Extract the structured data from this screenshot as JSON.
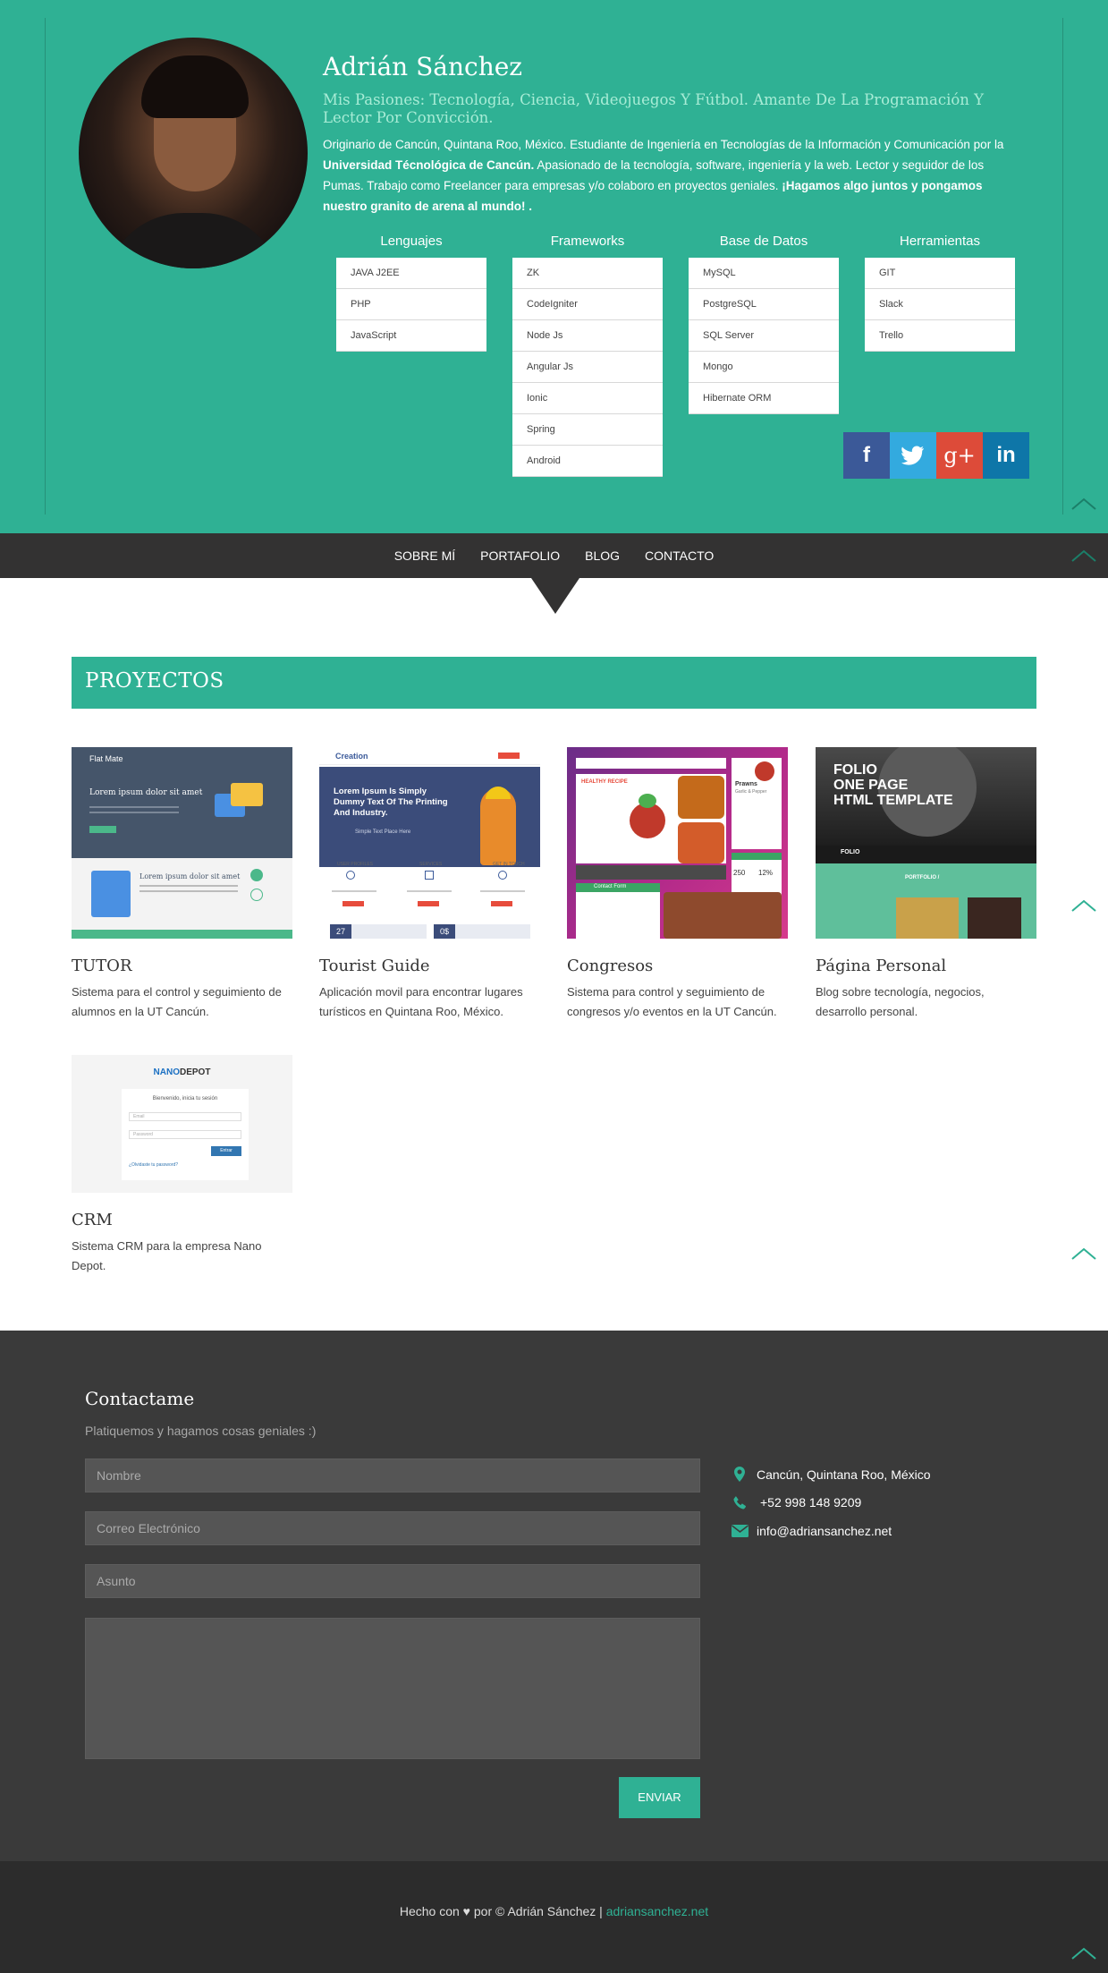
{
  "profile": {
    "name": "Adrián Sánchez",
    "tagline": "Mis Pasiones: Tecnología, Ciencia, Videojuegos Y Fútbol. Amante De La Programación Y Lector Por Convicción.",
    "bio_part1": "Originario de Cancún, Quintana Roo, México. Estudiante de Ingeniería en Tecnologías de la Información y Comunicación por la ",
    "bio_bold1": "Universidad Técnológica de Cancún.",
    "bio_part2": " Apasionado de la tecnología, software, ingeniería y la web. Lector y seguidor de los Pumas. Trabajo como Freelancer para empresas y/o colaboro en proyectos geniales. ",
    "bio_bold2": "¡Hagamos algo juntos y pongamos nuestro granito de arena al mundo! ."
  },
  "skills": [
    {
      "title": "Lenguajes",
      "items": [
        "JAVA J2EE",
        "PHP",
        "JavaScript"
      ]
    },
    {
      "title": "Frameworks",
      "items": [
        "ZK",
        "CodeIgniter",
        "Node Js",
        "Angular Js",
        "Ionic",
        "Spring",
        "Android"
      ]
    },
    {
      "title": "Base de Datos",
      "items": [
        "MySQL",
        "PostgreSQL",
        "SQL Server",
        "Mongo",
        "Hibernate ORM"
      ]
    },
    {
      "title": "Herramientas",
      "items": [
        "GIT",
        "Slack",
        "Trello"
      ]
    }
  ],
  "social": {
    "facebook": "f",
    "twitter": "t",
    "googleplus": "g+",
    "linkedin": "in"
  },
  "nav": [
    "SOBRE MÍ",
    "PORTAFOLIO",
    "BLOG",
    "CONTACTO"
  ],
  "projects_title": "PROYECTOS",
  "projects": [
    {
      "title": "TUTOR",
      "desc": "Sistema para el control y seguimiento de alumnos en la UT Cancún.",
      "thumb": {
        "brand": "Flat Mate",
        "hero": "Lorem ipsum dolor sit amet",
        "lower": "Lorem ipsum dolor sit amet"
      }
    },
    {
      "title": "Tourist Guide",
      "desc": "Aplicación movil para encontrar lugares turísticos en Quintana Roo, México.",
      "thumb": {
        "brand": "Creation",
        "hero": "Lorem Ipsum Is Simply Dummy Text Of The Printing And Industry.",
        "cta": "Simple Text Place Here",
        "cols": [
          "USER PROFILES",
          "SERVICES",
          "GET IN TOUCH"
        ],
        "nums": [
          "27",
          "0$"
        ]
      }
    },
    {
      "title": "Congresos",
      "desc": "Sistema para control y seguimiento de congresos y/o eventos en la UT Cancún.",
      "thumb": {
        "badge": "HEALTHY RECIPE",
        "card": "Prawns",
        "card_sub": "Garlic & Pepper",
        "stats": [
          "250",
          "12%"
        ],
        "form": "Contact Form"
      }
    },
    {
      "title": "Página Personal",
      "desc": "Blog sobre tecnología, negocios, desarrollo personal.",
      "thumb": {
        "line1": "FOLIO",
        "line2": "ONE PAGE",
        "line3": "HTML TEMPLATE",
        "nav_brand": "FOLIO",
        "section": "PORTFOLIO /"
      }
    },
    {
      "title": "CRM",
      "desc": "Sistema CRM para la empresa Nano Depot.",
      "thumb": {
        "brand_a": "NANO",
        "brand_b": "DEPOT",
        "welcome": "Bienvenido, inicia tu sesión",
        "email": "Email",
        "password": "Password",
        "button": "Entrar",
        "forgot": "¿Olvidaste tu password?"
      }
    }
  ],
  "contact": {
    "title": "Contactame",
    "subtitle": "Platiquemos y hagamos cosas geniales :)",
    "name_placeholder": "Nombre",
    "email_placeholder": "Correo Electrónico",
    "subject_placeholder": "Asunto",
    "send": "ENVIAR",
    "location": "Cancún, Quintana Roo, México",
    "phone": "+52 998 148 9209",
    "email": "info@adriansanchez.net"
  },
  "footer": {
    "text": "Hecho con ♥ por © Adrián Sánchez | ",
    "link": "adriansanchez.net"
  },
  "colors": {
    "accent": "#2fb194",
    "dark": "#333232",
    "contact_bg": "#3a3a3a",
    "footer_bg": "#2c2c2c"
  }
}
